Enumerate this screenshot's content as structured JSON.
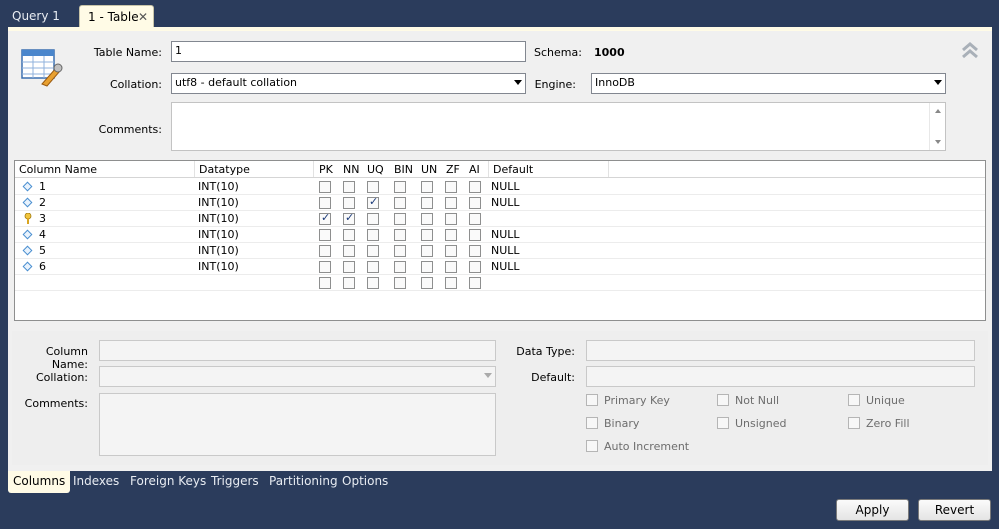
{
  "top_tabs": [
    {
      "label": "Query 1"
    },
    {
      "label": "1 - Table",
      "close": "✕"
    }
  ],
  "form": {
    "table_name_label": "Table Name:",
    "table_name_value": "1",
    "schema_label": "Schema:",
    "schema_value": "1000",
    "collation_label": "Collation:",
    "collation_value": "utf8 - default collation",
    "engine_label": "Engine:",
    "engine_value": "InnoDB",
    "comments_label": "Comments:",
    "comments_value": ""
  },
  "grid": {
    "headers": [
      "Column Name",
      "Datatype",
      "PK",
      "NN",
      "UQ",
      "BIN",
      "UN",
      "ZF",
      "AI",
      "Default"
    ],
    "rows": [
      {
        "name": "1",
        "type": "INT(10)",
        "icon": "diamond",
        "pk": false,
        "nn": false,
        "uq": false,
        "default": "NULL"
      },
      {
        "name": "2",
        "type": "INT(10)",
        "icon": "diamond",
        "pk": false,
        "nn": false,
        "uq": true,
        "default": "NULL"
      },
      {
        "name": "3",
        "type": "INT(10)",
        "icon": "key",
        "pk": true,
        "nn": true,
        "uq": false,
        "default": ""
      },
      {
        "name": "4",
        "type": "INT(10)",
        "icon": "diamond",
        "pk": false,
        "nn": false,
        "uq": false,
        "default": "NULL"
      },
      {
        "name": "5",
        "type": "INT(10)",
        "icon": "diamond",
        "pk": false,
        "nn": false,
        "uq": false,
        "default": "NULL"
      },
      {
        "name": "6",
        "type": "INT(10)",
        "icon": "diamond",
        "pk": false,
        "nn": false,
        "uq": false,
        "default": "NULL"
      }
    ]
  },
  "detail": {
    "column_name_label": "Column Name:",
    "collation_label": "Collation:",
    "comments_label": "Comments:",
    "data_type_label": "Data Type:",
    "default_label": "Default:",
    "options": {
      "primary_key": "Primary Key",
      "not_null": "Not Null",
      "unique": "Unique",
      "binary": "Binary",
      "unsigned": "Unsigned",
      "zero_fill": "Zero Fill",
      "auto_increment": "Auto Increment"
    }
  },
  "bottom_tabs": [
    "Columns",
    "Indexes",
    "Foreign Keys",
    "Triggers",
    "Partitioning",
    "Options"
  ],
  "buttons": {
    "apply": "Apply",
    "revert": "Revert"
  },
  "colors": {
    "chrome": "#2b3c5c",
    "active_tab": "#fffbe6",
    "panel": "#f0f0f0"
  }
}
